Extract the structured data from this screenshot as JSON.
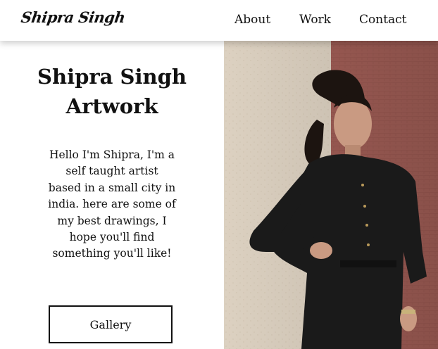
{
  "nav": {
    "logo": "Shipra Singh",
    "links": [
      "About",
      "Work",
      "Contact"
    ]
  },
  "hero": {
    "title_line1": "Shipra Singh",
    "title_line2": "Artwork",
    "intro": "Hello I'm Shipra, I'm a self taught artist based in a small city in india. here are some of my best drawings, I hope you'll find something you'll like!",
    "button_label": "Gallery"
  },
  "colors": {
    "wall_light": "#e8dccb",
    "wall_brick": "#a8625a",
    "outfit": "#1a1a1a",
    "skin": "#c99a82"
  }
}
